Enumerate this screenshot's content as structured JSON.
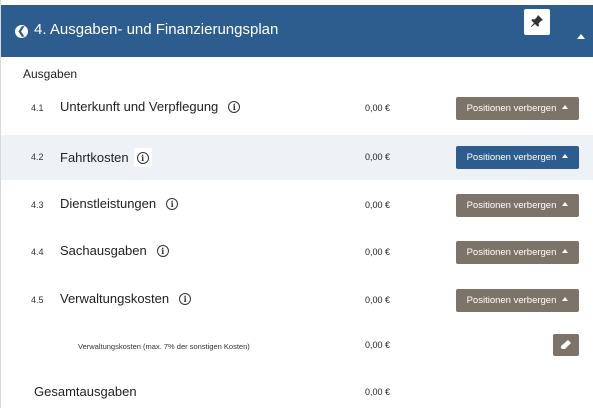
{
  "header": {
    "badge_icon": "chevron-left-icon",
    "title": "4. Ausgaben- und Finanzierungsplan",
    "pin_icon": "pin-icon",
    "collapse_icon": "caret-up-icon",
    "color": "#2d5d8f"
  },
  "section": {
    "label": "Ausgaben"
  },
  "rows": [
    {
      "num": "4.1",
      "name": "Unterkunft und Verpflegung",
      "amount": "0,00 €",
      "button": "Positionen verbergen"
    },
    {
      "num": "4.2",
      "name": "Fahrtkosten",
      "amount": "0,00 €",
      "button": "Positionen verbergen"
    },
    {
      "num": "4.3",
      "name": "Dienstleistungen",
      "amount": "0,00 €",
      "button": "Positionen verbergen"
    },
    {
      "num": "4.4",
      "name": "Sachausgaben",
      "amount": "0,00 €",
      "button": "Positionen verbergen"
    },
    {
      "num": "4.5",
      "name": "Verwaltungskosten",
      "amount": "0,00 €",
      "button": "Positionen verbergen"
    }
  ],
  "info_glyph": "i",
  "subrow": {
    "label": "Verwaltungskosten (max. 7% der sonstigen Kosten)",
    "amount": "0,00 €",
    "edit_icon": "eraser-icon"
  },
  "total": {
    "label": "Gesamtausgaben",
    "amount": "0,00 €"
  },
  "colors": {
    "button_gray": "#7e7368",
    "button_blue": "#2d5d8f",
    "highlight_row": "#eef1f6"
  }
}
